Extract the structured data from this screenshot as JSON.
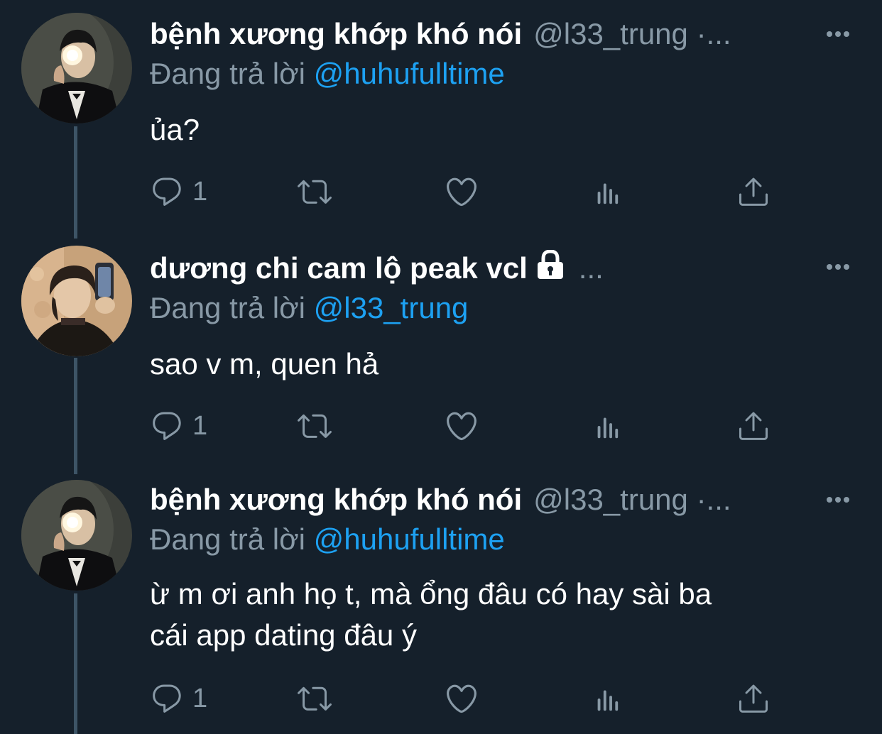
{
  "colors": {
    "background": "#15202b",
    "text_primary": "#ffffff",
    "text_secondary": "#8899a6",
    "link": "#1da1f2",
    "thread_line": "#3d5466"
  },
  "tweets": [
    {
      "name": "bệnh xương khớp khó nói",
      "handle": "@l33_trung ·...",
      "locked": false,
      "reply_prefix": "Đang trả lời ",
      "reply_to": "@huhufulltime",
      "text": "ủa?",
      "reply_count": "1",
      "icons": [
        "more-icon",
        "reply-icon",
        "retweet-icon",
        "like-icon",
        "analytics-icon",
        "share-icon"
      ]
    },
    {
      "name": "dương chi cam lộ peak vcl",
      "handle": "...",
      "locked": true,
      "reply_prefix": "Đang trả lời ",
      "reply_to": "@l33_trung",
      "text": "sao v m, quen hả",
      "reply_count": "1",
      "icons": [
        "lock-icon",
        "more-icon",
        "reply-icon",
        "retweet-icon",
        "like-icon",
        "analytics-icon",
        "share-icon"
      ]
    },
    {
      "name": "bệnh xương khớp khó nói",
      "handle": "@l33_trung ·...",
      "locked": false,
      "reply_prefix": "Đang trả lời ",
      "reply_to": "@huhufulltime",
      "text_line1": "ừ m ơi anh họ t, mà ổng đâu có hay sài ba",
      "text_line2": "cái app dating đâu ý",
      "reply_count": "1",
      "icons": [
        "more-icon",
        "reply-icon",
        "retweet-icon",
        "like-icon",
        "analytics-icon",
        "share-icon"
      ]
    }
  ]
}
